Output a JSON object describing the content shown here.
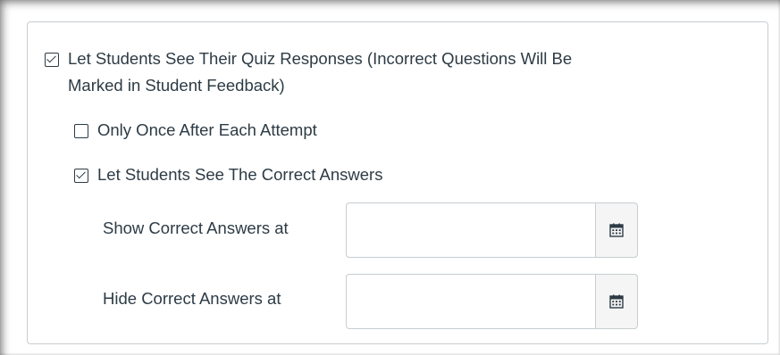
{
  "options": {
    "see_responses": {
      "checked": true,
      "label_line1": "Let Students See Their Quiz Responses (Incorrect Questions Will Be",
      "label_line2": "Marked in Student Feedback)"
    },
    "only_once": {
      "checked": false,
      "label": "Only Once After Each Attempt"
    },
    "see_correct": {
      "checked": true,
      "label": "Let Students See The Correct Answers"
    }
  },
  "dates": {
    "show": {
      "label": "Show Correct Answers at",
      "value": "",
      "button_icon": "calendar-icon"
    },
    "hide": {
      "label": "Hide Correct Answers at",
      "value": "",
      "button_icon": "calendar-icon"
    }
  },
  "colors": {
    "text": "#2d3b45",
    "border": "#c7cdd1",
    "button_bg": "#f5f5f5"
  }
}
